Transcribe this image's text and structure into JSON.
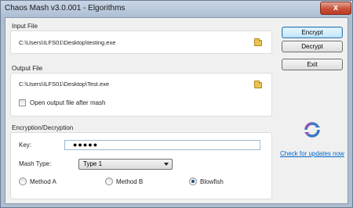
{
  "window": {
    "title": "Chaos Mash v3.0.001 - Elgorithms",
    "close_glyph": "x"
  },
  "input_file": {
    "label": "Input File",
    "path": "C:\\Users\\ILFS01\\Desktop\\testing.exe"
  },
  "output_file": {
    "label": "Output File",
    "path": "C:\\Users\\ILFS01\\Desktop\\Test.exe",
    "open_after_label": "Open output file after mash",
    "open_after_checked": false
  },
  "buttons": {
    "encrypt": "Encrypt",
    "decrypt": "Decrypt",
    "exit": "Exit"
  },
  "encryption": {
    "label": "Encryption/Decryption",
    "key_label": "Key:",
    "key_value": "●●●●●",
    "mash_type_label": "Mash Type:",
    "mash_type_value": "Type 1",
    "methods": [
      {
        "label": "Method A",
        "checked": false
      },
      {
        "label": "Method B",
        "checked": false
      },
      {
        "label": "Blowfish",
        "checked": true
      }
    ]
  },
  "updates": {
    "link_text": "Check for updates now"
  },
  "icons": {
    "folder": "folder-icon",
    "refresh": "refresh-update-icon"
  },
  "colors": {
    "title_bar": "#aebfd5",
    "close_button": "#c8503a",
    "link": "#0066cc",
    "default_button": "#bee6fd"
  }
}
